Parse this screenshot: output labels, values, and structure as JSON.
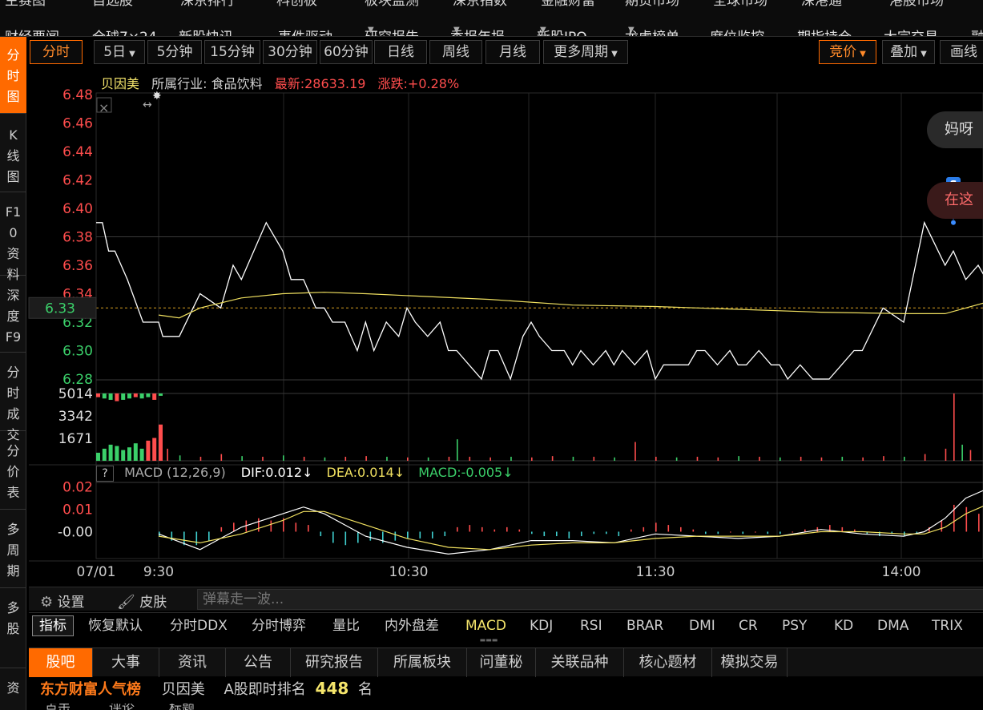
{
  "topnav": {
    "cut_items": [
      "主赛图",
      "自选股",
      "深京排行",
      "科创板",
      "板块监测",
      "深京指数",
      "金融财富",
      "期货市场",
      "全球市场",
      "深港通",
      "港股市场"
    ],
    "items": [
      {
        "label": "财经要闻",
        "dropdown": false
      },
      {
        "label": "全球7×24",
        "dropdown": false
      },
      {
        "label": "新股快讯",
        "dropdown": false
      },
      {
        "label": "事件驱动",
        "dropdown": false
      },
      {
        "label": "研究报告",
        "dropdown": true
      },
      {
        "label": "季报年报",
        "dropdown": true
      },
      {
        "label": "新股IPO",
        "dropdown": true
      },
      {
        "label": "龙虎榜单",
        "dropdown": true
      },
      {
        "label": "席位监控",
        "dropdown": false
      },
      {
        "label": "期指持仓",
        "dropdown": false
      },
      {
        "label": "大宗交易",
        "dropdown": false
      },
      {
        "label": "融",
        "dropdown": false
      }
    ]
  },
  "lefttabs": [
    {
      "label": "分时图",
      "active": true
    },
    {
      "label": "K线图",
      "active": false
    },
    {
      "label": "F10资料",
      "active": false
    },
    {
      "label": "深度F9",
      "active": false
    },
    {
      "label": "分时成交",
      "active": false
    },
    {
      "label": "分价表",
      "active": false
    },
    {
      "label": "多周期",
      "active": false
    },
    {
      "label": "多股",
      "active": false
    },
    {
      "label": "资",
      "active": false
    }
  ],
  "toolbar": {
    "periods": [
      {
        "label": "分时",
        "active": true,
        "dropdown": false
      },
      {
        "label": "5日",
        "active": false,
        "dropdown": true
      },
      {
        "label": "5分钟",
        "active": false,
        "dropdown": false
      },
      {
        "label": "15分钟",
        "active": false,
        "dropdown": false
      },
      {
        "label": "30分钟",
        "active": false,
        "dropdown": false
      },
      {
        "label": "60分钟",
        "active": false,
        "dropdown": false
      },
      {
        "label": "日线",
        "active": false,
        "dropdown": false
      },
      {
        "label": "周线",
        "active": false,
        "dropdown": false
      },
      {
        "label": "月线",
        "active": false,
        "dropdown": false
      },
      {
        "label": "更多周期",
        "active": false,
        "dropdown": true
      }
    ],
    "right": [
      {
        "label": "竞价",
        "active": true,
        "dropdown": true
      },
      {
        "label": "叠加",
        "active": false,
        "dropdown": true
      },
      {
        "label": "画线",
        "active": false,
        "dropdown": false
      }
    ]
  },
  "stock": {
    "name": "贝因美",
    "industry": "所属行业: 食品饮料",
    "latest": "最新:28633.19",
    "change": "涨跌:+0.28%",
    "current_price_label": "6.33"
  },
  "colors": {
    "up": "#ff4d4d",
    "down": "#3bd06a",
    "accent": "#ff6a00",
    "avg_line": "#f0e060",
    "price_line": "#ffffff"
  },
  "chart_data": {
    "type": "line",
    "price_axis": {
      "ylim": [
        6.28,
        6.48
      ],
      "ticks": [
        "6.48",
        "6.46",
        "6.44",
        "6.42",
        "6.40",
        "6.38",
        "6.36",
        "6.34",
        "6.32",
        "6.30",
        "6.28"
      ],
      "reference": 6.33
    },
    "x_ticks": [
      "07/01",
      "9:30",
      "10:30",
      "11:30",
      "14:00"
    ],
    "price_series": {
      "name": "price",
      "x": [
        0,
        2,
        4,
        6,
        10,
        15,
        20,
        21,
        25,
        30,
        35,
        38,
        40,
        43,
        46,
        50,
        52,
        55,
        58,
        60,
        62,
        65,
        68,
        70,
        72,
        75,
        78,
        80,
        82,
        85,
        88,
        90,
        92,
        95,
        98,
        100,
        102,
        105,
        108,
        110,
        112,
        115,
        118,
        120,
        122,
        125,
        128,
        130,
        132,
        135,
        138,
        140,
        142,
        145,
        148,
        150,
        152,
        155,
        158,
        160,
        162,
        165,
        168,
        170,
        172,
        175,
        178,
        180,
        182,
        185,
        188,
        190,
        195,
        200,
        205,
        210,
        212,
        215,
        218,
        220,
        222,
        225,
        228,
        230,
        235,
        238,
        240,
        243,
        248
      ],
      "y": [
        6.39,
        6.39,
        6.37,
        6.37,
        6.35,
        6.32,
        6.32,
        6.31,
        6.31,
        6.34,
        6.33,
        6.36,
        6.35,
        6.37,
        6.39,
        6.37,
        6.35,
        6.35,
        6.33,
        6.33,
        6.32,
        6.32,
        6.3,
        6.32,
        6.3,
        6.32,
        6.31,
        6.33,
        6.32,
        6.31,
        6.32,
        6.3,
        6.3,
        6.29,
        6.28,
        6.3,
        6.3,
        6.28,
        6.31,
        6.32,
        6.31,
        6.3,
        6.3,
        6.29,
        6.3,
        6.29,
        6.3,
        6.29,
        6.3,
        6.29,
        6.3,
        6.28,
        6.29,
        6.29,
        6.29,
        6.3,
        6.3,
        6.29,
        6.3,
        6.29,
        6.29,
        6.3,
        6.29,
        6.29,
        6.28,
        6.29,
        6.28,
        6.28,
        6.28,
        6.29,
        6.3,
        6.3,
        6.33,
        6.32,
        6.39,
        6.36,
        6.37,
        6.35,
        6.36,
        6.35,
        6.33,
        6.33,
        6.33,
        6.33,
        6.33,
        6.33,
        6.33,
        6.33,
        6.33
      ]
    },
    "avg_series": {
      "name": "avg",
      "x": [
        20,
        25,
        30,
        40,
        50,
        60,
        70,
        100,
        120,
        140,
        160,
        180,
        200,
        210,
        215,
        220,
        225,
        230
      ],
      "y": [
        6.325,
        6.323,
        6.33,
        6.337,
        6.34,
        6.341,
        6.34,
        6.336,
        6.332,
        6.331,
        6.329,
        6.327,
        6.326,
        6.326,
        6.33,
        6.334,
        6.334,
        6.333
      ]
    },
    "signal_marker": {
      "label": "S",
      "x": 212,
      "y": 6.39
    },
    "volume_axis": {
      "ticks": [
        "5014",
        "3342",
        "1671"
      ],
      "max": 5014
    },
    "volume": {
      "pre_open_x": [
        0,
        2,
        4,
        6,
        8,
        10,
        12,
        14,
        16,
        18,
        20
      ],
      "pre_open_v": [
        4800,
        4700,
        4600,
        4500,
        4600,
        4700,
        4800,
        4700,
        4800,
        4600,
        4900
      ],
      "pre_open_bot_v": [
        600,
        900,
        1200,
        1100,
        800,
        1000,
        1300,
        900,
        1500,
        1700,
        2700
      ],
      "x": [
        22,
        25,
        30,
        35,
        40,
        45,
        50,
        55,
        60,
        65,
        70,
        75,
        80,
        85,
        90,
        92,
        95,
        100,
        105,
        110,
        115,
        120,
        125,
        130,
        135,
        140,
        145,
        150,
        155,
        160,
        165,
        170,
        175,
        180,
        185,
        190,
        195,
        200,
        205,
        210,
        212,
        214,
        216,
        220,
        225,
        230
      ],
      "v": [
        900,
        400,
        300,
        500,
        350,
        300,
        400,
        300,
        250,
        300,
        350,
        300,
        250,
        250,
        300,
        1600,
        300,
        250,
        300,
        250,
        350,
        300,
        300,
        250,
        1400,
        300,
        250,
        300,
        250,
        350,
        300,
        250,
        300,
        250,
        300,
        250,
        350,
        300,
        500,
        900,
        5014,
        1200,
        800,
        700,
        400,
        300
      ],
      "up": [
        true,
        false,
        true,
        true,
        false,
        true,
        false,
        true,
        false,
        true,
        true,
        false,
        true,
        false,
        true,
        false,
        true,
        true,
        false,
        true,
        true,
        false,
        true,
        false,
        true,
        true,
        false,
        true,
        true,
        false,
        true,
        false,
        true,
        true,
        false,
        true,
        true,
        false,
        true,
        true,
        true,
        false,
        true,
        false,
        true,
        false
      ]
    },
    "macd": {
      "title": "MACD (12,26,9)",
      "dif_label": "DIF:0.012",
      "dea_label": "DEA:0.014",
      "macd_label": "MACD:-0.005",
      "ylim": [
        -0.012,
        0.022
      ],
      "ticks": [
        "0.02",
        "0.01",
        "-0.00"
      ],
      "dif": {
        "x": [
          20,
          30,
          40,
          50,
          55,
          60,
          70,
          80,
          90,
          100,
          110,
          120,
          130,
          140,
          150,
          160,
          170,
          180,
          190,
          200,
          205,
          210,
          215,
          220,
          225,
          230
        ],
        "y": [
          -0.001,
          -0.008,
          0.002,
          0.008,
          0.011,
          0.008,
          -0.002,
          -0.007,
          -0.01,
          -0.008,
          -0.004,
          -0.004,
          -0.005,
          -0.001,
          -0.002,
          -0.003,
          -0.002,
          0.001,
          -0.001,
          -0.002,
          0.0,
          0.006,
          0.015,
          0.019,
          0.018,
          0.014
        ]
      },
      "dea": {
        "x": [
          20,
          30,
          40,
          50,
          55,
          60,
          70,
          80,
          90,
          100,
          110,
          120,
          130,
          140,
          150,
          160,
          170,
          180,
          190,
          200,
          205,
          210,
          215,
          220,
          225,
          230
        ],
        "y": [
          -0.002,
          -0.005,
          -0.001,
          0.005,
          0.009,
          0.009,
          0.003,
          -0.003,
          -0.007,
          -0.008,
          -0.006,
          -0.005,
          -0.005,
          -0.003,
          -0.002,
          -0.002,
          -0.002,
          0.0,
          0.0,
          -0.001,
          -0.001,
          0.002,
          0.008,
          0.012,
          0.015,
          0.014
        ]
      },
      "hist_x": [
        20,
        23,
        26,
        29,
        32,
        35,
        38,
        41,
        44,
        47,
        50,
        53,
        56,
        59,
        62,
        65,
        68,
        71,
        74,
        77,
        80,
        83,
        86,
        89,
        92,
        95,
        98,
        101,
        104,
        107,
        110,
        113,
        116,
        119,
        122,
        125,
        128,
        131,
        134,
        137,
        140,
        143,
        146,
        149,
        152,
        155,
        158,
        161,
        164,
        167,
        170,
        173,
        176,
        179,
        182,
        185,
        188,
        191,
        194,
        197,
        200,
        203,
        206,
        209,
        212,
        215,
        218,
        221,
        224,
        227,
        230
      ],
      "hist_y": [
        -0.002,
        -0.004,
        -0.006,
        -0.006,
        -0.004,
        0.002,
        0.004,
        0.005,
        0.006,
        0.005,
        0.006,
        0.004,
        0.003,
        -0.002,
        -0.005,
        -0.006,
        -0.005,
        -0.004,
        -0.005,
        -0.004,
        -0.003,
        -0.003,
        -0.003,
        -0.002,
        0.002,
        0.003,
        0.002,
        0.001,
        0.002,
        0.001,
        -0.001,
        -0.002,
        -0.002,
        -0.003,
        -0.002,
        -0.001,
        -0.001,
        -0.002,
        0.001,
        0.002,
        0.004,
        0.003,
        0.002,
        0.001,
        -0.001,
        -0.001,
        0.0,
        -0.001,
        0.0,
        -0.001,
        -0.001,
        0.0,
        0.001,
        0.002,
        0.003,
        0.002,
        0.001,
        -0.001,
        -0.002,
        -0.001,
        -0.002,
        -0.001,
        0.002,
        0.005,
        0.012,
        0.011,
        0.008,
        0.006,
        0.004,
        0.002,
        -0.004
      ]
    }
  },
  "settingsbar": {
    "settings": "设置",
    "skin": "皮肤",
    "danmu_placeholder": "弹幕走一波..."
  },
  "indicators": [
    {
      "label": "指标",
      "active": true,
      "highlight": false
    },
    {
      "label": "恢复默认",
      "active": false,
      "highlight": false
    },
    {
      "label": "分时DDX",
      "active": false,
      "highlight": false
    },
    {
      "label": "分时博弈",
      "active": false,
      "highlight": false
    },
    {
      "label": "量比",
      "active": false,
      "highlight": false
    },
    {
      "label": "内外盘差",
      "active": false,
      "highlight": false
    },
    {
      "label": "MACD",
      "active": false,
      "highlight": true
    },
    {
      "label": "KDJ",
      "active": false,
      "highlight": false
    },
    {
      "label": "RSI",
      "active": false,
      "highlight": false
    },
    {
      "label": "BRAR",
      "active": false,
      "highlight": false
    },
    {
      "label": "DMI",
      "active": false,
      "highlight": false
    },
    {
      "label": "CR",
      "active": false,
      "highlight": false
    },
    {
      "label": "PSY",
      "active": false,
      "highlight": false
    },
    {
      "label": "KD",
      "active": false,
      "highlight": false
    },
    {
      "label": "DMA",
      "active": false,
      "highlight": false
    },
    {
      "label": "TRIX",
      "active": false,
      "highlight": false
    }
  ],
  "bottomtabs": [
    {
      "label": "股吧",
      "active": true
    },
    {
      "label": "大事",
      "active": false
    },
    {
      "label": "资讯",
      "active": false
    },
    {
      "label": "公告",
      "active": false
    },
    {
      "label": "研究报告",
      "active": false
    },
    {
      "label": "所属板块",
      "active": false
    },
    {
      "label": "问董秘",
      "active": false
    },
    {
      "label": "关联品种",
      "active": false
    },
    {
      "label": "核心题材",
      "active": false
    },
    {
      "label": "模拟交易",
      "active": false
    }
  ],
  "rank": {
    "brand": "东方财富人气榜",
    "stock": "贝因美",
    "label": "A股即时排名",
    "number": "448",
    "unit": "名"
  },
  "bottomcut": [
    "点击",
    "评论",
    "标题"
  ],
  "bubbles": [
    "妈呀",
    "在这"
  ]
}
